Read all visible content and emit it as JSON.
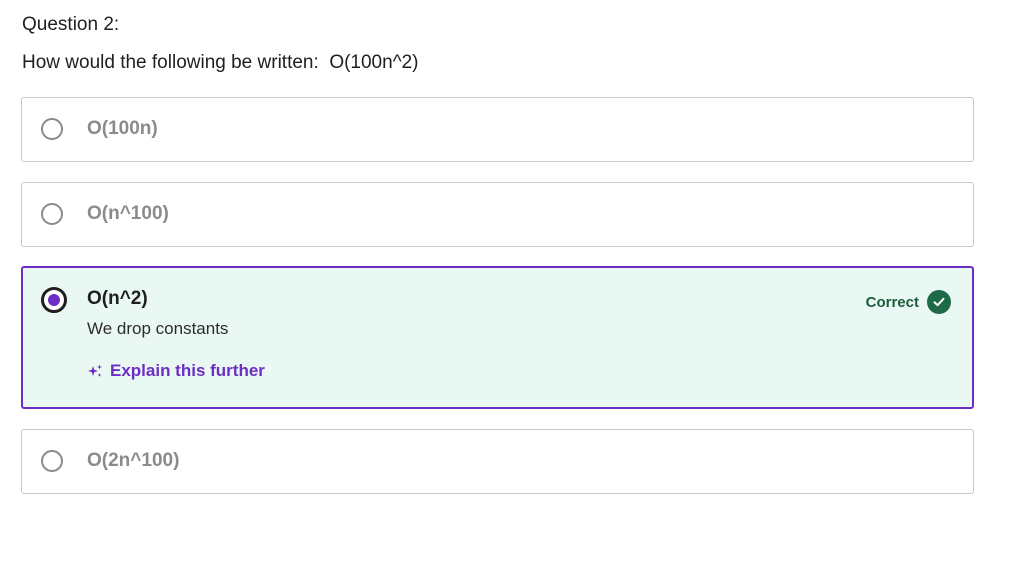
{
  "question": {
    "label": "Question 2:",
    "text": "How would the following be written:  O(100n^2)"
  },
  "options": [
    {
      "label": "O(100n)",
      "selected": false
    },
    {
      "label": "O(n^100)",
      "selected": false
    },
    {
      "label": "O(n^2)",
      "selected": true,
      "status": "Correct",
      "feedback": "We drop constants",
      "explain_label": "Explain this further"
    },
    {
      "label": "O(2n^100)",
      "selected": false
    }
  ],
  "colors": {
    "accent": "#6d2ec6",
    "correct_bg": "#e9f8f2",
    "correct_badge": "#1f6a46",
    "correct_text": "#1d5c3c"
  },
  "icons": [
    "radio-icon",
    "sparkle-icon",
    "check-circle-icon"
  ]
}
